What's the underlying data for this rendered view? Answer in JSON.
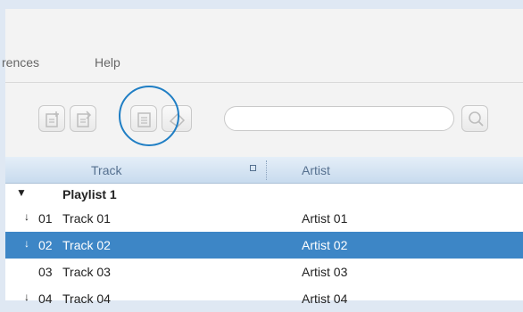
{
  "menu": {
    "prefs_label": "rences",
    "help_label": "Help"
  },
  "toolbar": {
    "search_value": "",
    "search_placeholder": ""
  },
  "grid": {
    "columns": {
      "track": "Track",
      "artist": "Artist"
    },
    "group": {
      "label": "Playlist 1",
      "toggle": "▼"
    },
    "rows": [
      {
        "dl": "↓",
        "num": "01",
        "title": "Track 01",
        "artist": "Artist 01"
      },
      {
        "dl": "↓",
        "num": "02",
        "title": "Track 02",
        "artist": "Artist 02"
      },
      {
        "dl": "",
        "num": "03",
        "title": "Track 03",
        "artist": "Artist 03"
      },
      {
        "dl": "↓",
        "num": "04",
        "title": "Track 04",
        "artist": "Artist 04"
      }
    ]
  },
  "colors": {
    "selection": "#3d86c6",
    "highlight_ring": "#1f7ec4"
  }
}
